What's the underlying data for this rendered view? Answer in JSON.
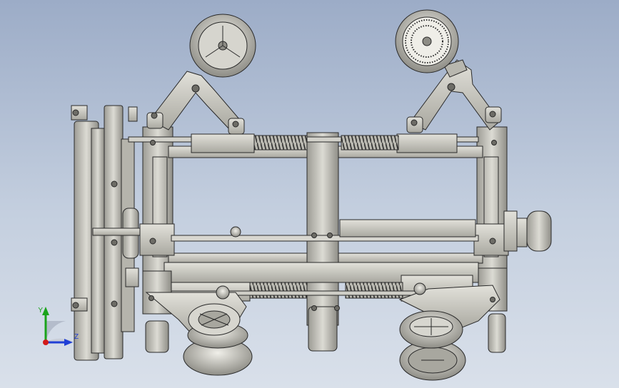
{
  "viewport": {
    "background_top": "#9cacc7",
    "background_bottom": "#d9e0ea"
  },
  "model": {
    "metal_color": "#c9c8c0",
    "metal_dark": "#8d8c85",
    "edge_color": "#2a2a2a",
    "spring_color": "#3a3a3a"
  },
  "triad": {
    "y_label": "Y",
    "z_label": "Z",
    "y_color": "#1aa31a",
    "z_color": "#1f3fd6",
    "x_color": "#d21a1a",
    "icon": "coordinate-triad-icon"
  }
}
